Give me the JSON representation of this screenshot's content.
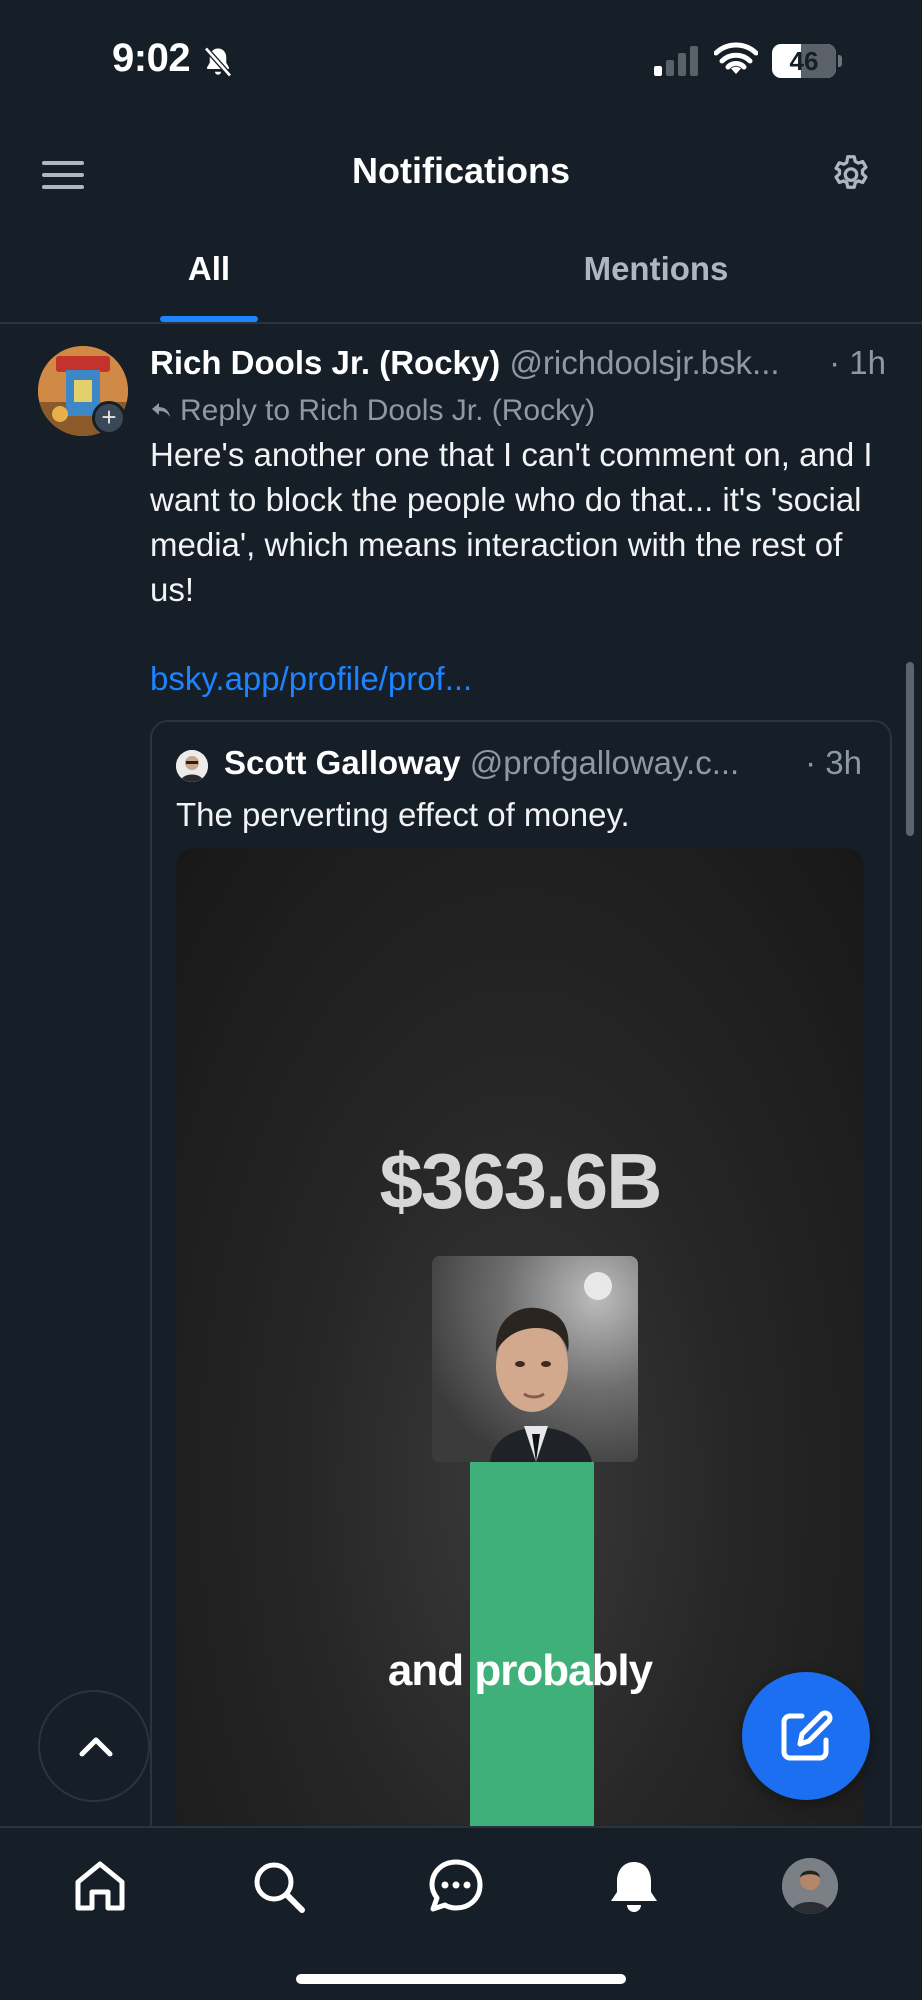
{
  "status_bar": {
    "time": "9:02",
    "battery": "46",
    "battery_level": 0.46,
    "icons": [
      "bell-slash-icon",
      "cellular-signal-icon",
      "wifi-icon",
      "battery-icon"
    ]
  },
  "header": {
    "title": "Notifications",
    "menu_icon": "hamburger-menu-icon",
    "settings_icon": "gear-icon"
  },
  "tabs": [
    {
      "label": "All",
      "active": true
    },
    {
      "label": "Mentions",
      "active": false
    }
  ],
  "post": {
    "author_name": "Rich Dools Jr. (Rocky)",
    "author_handle": "@richdoolsjr.bsk...",
    "time": "· 1h",
    "reply_to": "Reply to Rich Dools Jr. (Rocky)",
    "text": "Here's another one that I can't comment on, and I want to block the people who do that... it's 'social media', which means interaction with the rest of us!",
    "link": "bsky.app/profile/prof...",
    "quote": {
      "author_name": "Scott Galloway",
      "author_handle": "@profgalloway.c...",
      "time": "· 3h",
      "text": "The perverting effect of money.",
      "video": {
        "amount": "$363.6B",
        "caption": "and probably"
      }
    }
  },
  "bottom_nav": {
    "items": [
      "home-icon",
      "search-icon",
      "chat-icon",
      "bell-icon",
      "profile-avatar"
    ]
  },
  "colors": {
    "background": "#161e27",
    "accent": "#1d83ff",
    "muted": "#8e99a6",
    "bar_green": "#3fb07a"
  }
}
